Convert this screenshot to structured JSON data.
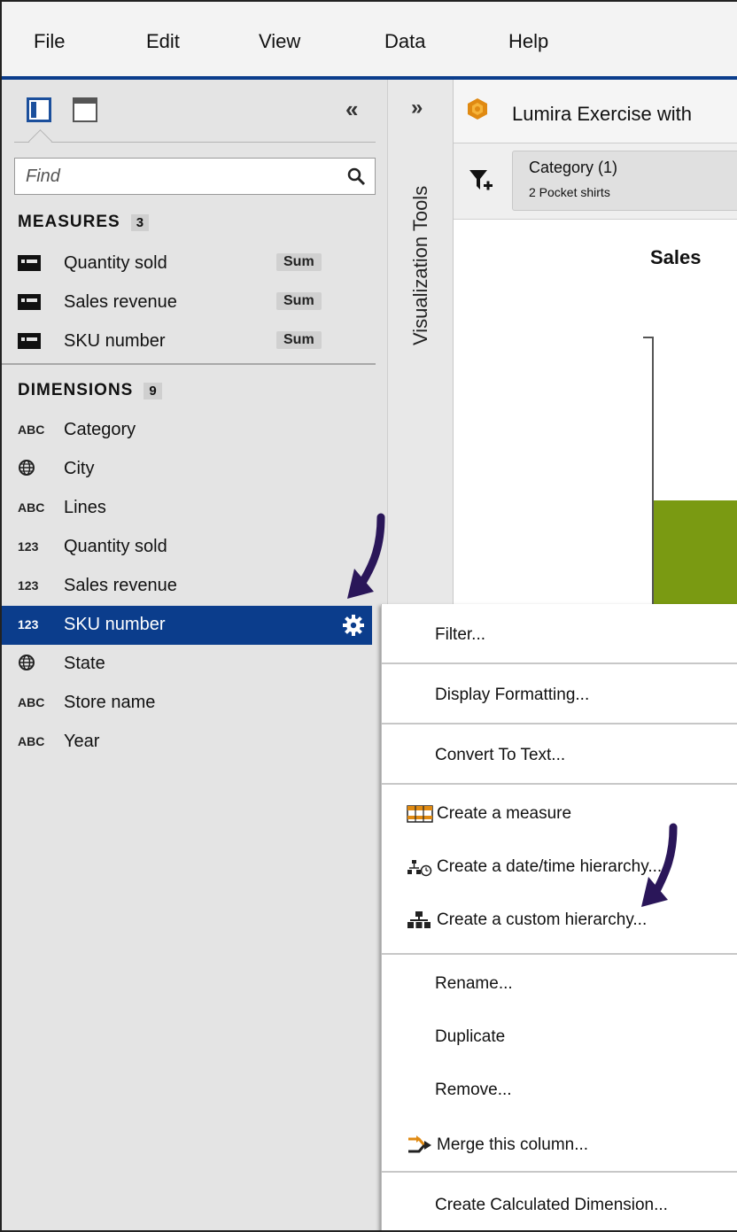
{
  "menubar": {
    "items": [
      "File",
      "Edit",
      "View",
      "Data",
      "Help"
    ]
  },
  "sidebar": {
    "collapse_glyph": "«",
    "search": {
      "placeholder": "Find",
      "value": ""
    },
    "measures": {
      "heading": "MEASURES",
      "count": "3",
      "items": [
        {
          "label": "Quantity sold",
          "agg": "Sum",
          "icon": "measure-icon"
        },
        {
          "label": "Sales revenue",
          "agg": "Sum",
          "icon": "measure-icon"
        },
        {
          "label": "SKU number",
          "agg": "Sum",
          "icon": "measure-icon"
        }
      ]
    },
    "dimensions": {
      "heading": "DIMENSIONS",
      "count": "9",
      "items": [
        {
          "type": "ABC",
          "label": "Category"
        },
        {
          "type": "geo",
          "label": "City"
        },
        {
          "type": "ABC",
          "label": "Lines"
        },
        {
          "type": "123",
          "label": "Quantity sold"
        },
        {
          "type": "123",
          "label": "Sales revenue"
        },
        {
          "type": "123",
          "label": "SKU number",
          "selected": true
        },
        {
          "type": "geo",
          "label": "State"
        },
        {
          "type": "ABC",
          "label": "Store name"
        },
        {
          "type": "ABC",
          "label": "Year"
        }
      ]
    }
  },
  "viz_tools": {
    "expand_glyph": "»",
    "label": "Visualization Tools"
  },
  "main": {
    "document_title": "Lumira Exercise with",
    "filter": {
      "title": "Category (1)",
      "value": "2 Pocket shirts"
    },
    "chart_title": "Sales"
  },
  "context_menu": {
    "items": [
      {
        "label": "Filter...",
        "icon": ""
      },
      {
        "label": "Display Formatting...",
        "icon": ""
      },
      {
        "label": "Convert To Text...",
        "icon": ""
      },
      {
        "label": "Create a measure",
        "icon": "measure-icon"
      },
      {
        "label": "Create a date/time hierarchy...",
        "icon": "datetime-hierarchy-icon"
      },
      {
        "label": "Create a custom hierarchy...",
        "icon": "hierarchy-icon"
      },
      {
        "label": "Rename...",
        "icon": ""
      },
      {
        "label": "Duplicate",
        "icon": ""
      },
      {
        "label": "Remove...",
        "icon": ""
      },
      {
        "label": "Merge this column...",
        "icon": "merge-icon"
      },
      {
        "label": "Create Calculated Dimension...",
        "icon": ""
      }
    ]
  },
  "colors": {
    "menubar_accent": "#0b3d8c",
    "selection": "#0b3d8c",
    "chart_bar": "#7a9a12",
    "annotation_arrow": "#2a1659"
  }
}
